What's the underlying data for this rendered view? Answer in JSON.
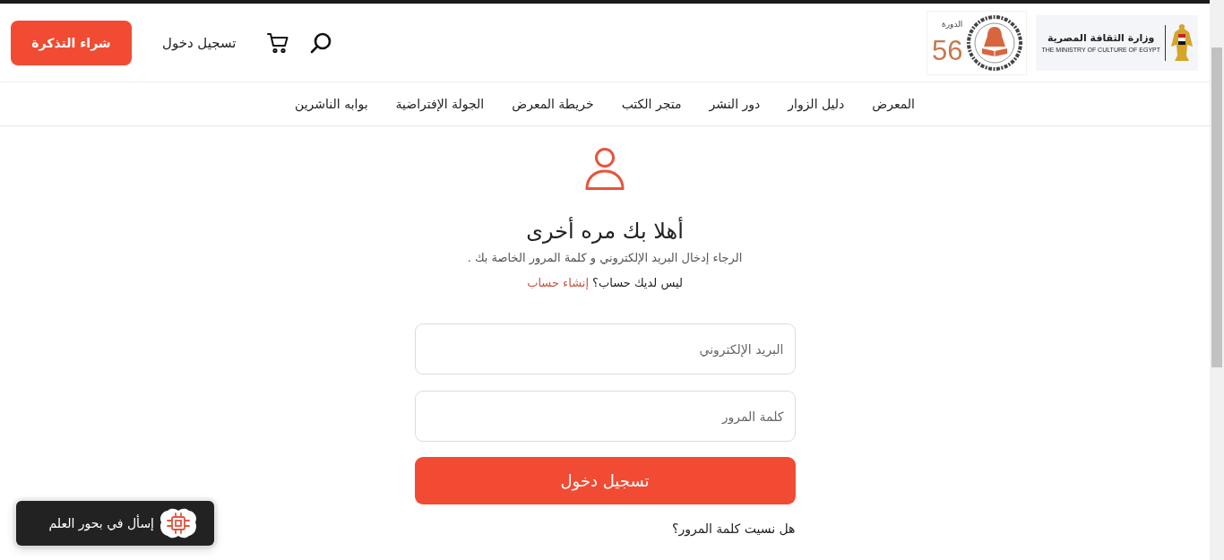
{
  "header": {
    "logos": [
      {
        "kind": "ministry",
        "name": "وزارة الثقافة المصرية",
        "subtitle": "THE MINISTRY OF CULTURE OF EGYPT"
      },
      {
        "kind": "edition",
        "caption": "الدورة",
        "number": "56"
      }
    ],
    "login_link": "تسجيل دخول",
    "buy_ticket": "شراء التذكرة"
  },
  "nav": {
    "items": [
      "المعرض",
      "دليل الزوار",
      "دور النشر",
      "متجر الكتب",
      "خريطة المعرض",
      "الجولة الإفتراضية",
      "بوابه الناشرين"
    ]
  },
  "login": {
    "title": "أهلا بك مره أخرى",
    "subtitle": "الرجاء إدخال البريد الإلكتروني و كلمة المرور الخاصة بك .",
    "signup_prompt": "ليس لديك حساب؟",
    "signup_link": "إنشاء حساب",
    "fields": [
      {
        "placeholder": "البريد الإلكتروني"
      },
      {
        "placeholder": "كلمة المرور"
      }
    ],
    "submit": "تسجيل دخول",
    "forgot": "هل نسيت كلمة المرور؟"
  },
  "chat_widget": {
    "label": "إسأل في بحور العلم"
  }
}
